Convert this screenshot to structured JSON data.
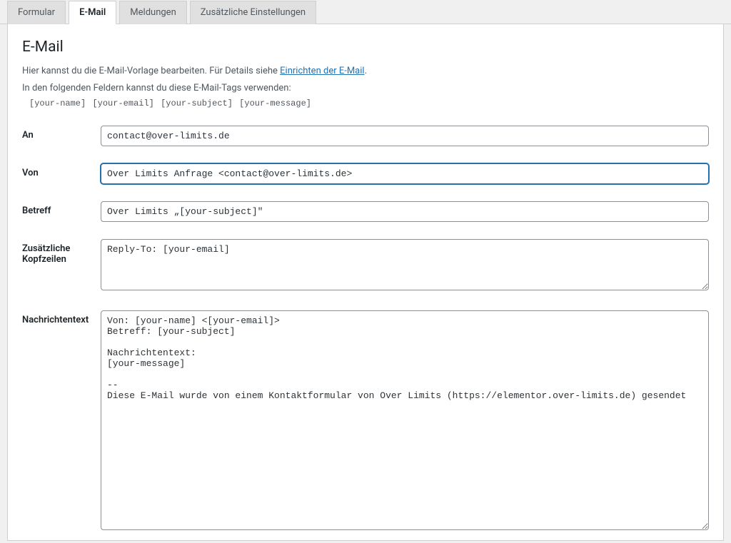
{
  "tabs": {
    "formular": "Formular",
    "email": "E-Mail",
    "meldungen": "Meldungen",
    "zus": "Zusätzliche Einstellungen"
  },
  "heading": "E-Mail",
  "intro": {
    "line1_a": "Hier kannst du die E-Mail-Vorlage bearbeiten. Für Details siehe ",
    "link": "Einrichten der E-Mail",
    "line1_b": ".",
    "line2": "In den folgenden Feldern kannst du diese E-Mail-Tags verwenden:"
  },
  "tags": {
    "t1": "[your-name]",
    "t2": "[your-email]",
    "t3": "[your-subject]",
    "t4": "[your-message]"
  },
  "labels": {
    "an": "An",
    "von": "Von",
    "betreff": "Betreff",
    "headers": "Zusätzliche Kopfzeilen",
    "body": "Nachrichtentext"
  },
  "fields": {
    "an": "contact@over-limits.de",
    "von": "Over Limits Anfrage <contact@over-limits.de>",
    "betreff": "Over Limits „[your-subject]\"",
    "headers": "Reply-To: [your-email]",
    "body": "Von: [your-name] <[your-email]>\nBetreff: [your-subject]\n\nNachrichtentext:\n[your-message]\n\n-- \nDiese E-Mail wurde von einem Kontaktformular von Over Limits (https://elementor.over-limits.de) gesendet"
  }
}
